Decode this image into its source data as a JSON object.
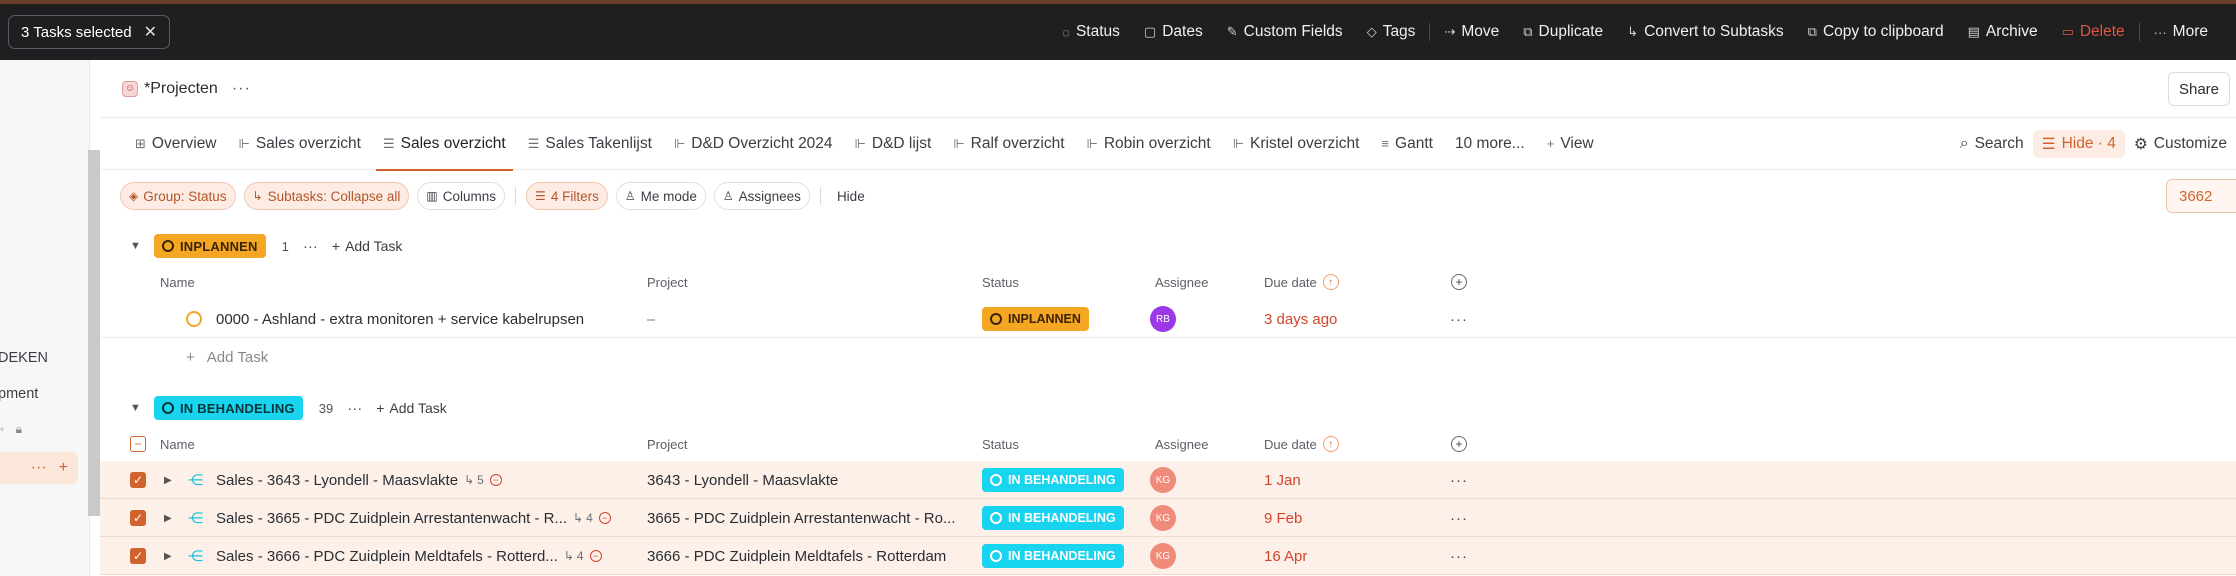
{
  "selection_bar": {
    "selected_label": "3 Tasks selected",
    "close_glyph": "✕",
    "actions": [
      {
        "label": "Status",
        "icon": "status-icon",
        "glyph": "◌"
      },
      {
        "label": "Dates",
        "icon": "calendar-icon",
        "glyph": "▢"
      },
      {
        "label": "Custom Fields",
        "icon": "edit-icon",
        "glyph": "✎"
      },
      {
        "label": "Tags",
        "icon": "tag-icon",
        "glyph": "◇"
      }
    ],
    "actions2": [
      {
        "label": "Move",
        "icon": "move-icon",
        "glyph": "⇢"
      },
      {
        "label": "Duplicate",
        "icon": "duplicate-icon",
        "glyph": "⧉"
      },
      {
        "label": "Convert to Subtasks",
        "icon": "subtask-icon",
        "glyph": "↳"
      },
      {
        "label": "Copy to clipboard",
        "icon": "copy-icon",
        "glyph": "⧉"
      },
      {
        "label": "Archive",
        "icon": "archive-icon",
        "glyph": "▤"
      },
      {
        "label": "Delete",
        "icon": "trash-icon",
        "glyph": "🗑"
      },
      {
        "label": "More",
        "icon": "more-icon",
        "glyph": "···"
      }
    ]
  },
  "sidebar": {
    "items": [
      {
        "label": "DEKEN"
      },
      {
        "label": "pment"
      }
    ]
  },
  "header": {
    "project_title": "*Projecten",
    "menu_glyph": "···",
    "share_label": "Share"
  },
  "tabs": {
    "items": [
      {
        "label": "Overview",
        "icon": "overview-icon",
        "glyph": "⊞"
      },
      {
        "label": "Sales overzicht",
        "icon": "board-icon",
        "glyph": "⊩"
      },
      {
        "label": "Sales overzicht",
        "icon": "list-icon",
        "glyph": "☰",
        "active": true
      },
      {
        "label": "Sales Takenlijst",
        "icon": "list-icon",
        "glyph": "☰"
      },
      {
        "label": "D&D Overzicht 2024",
        "icon": "board-icon",
        "glyph": "⊩"
      },
      {
        "label": "D&D lijst",
        "icon": "board-icon",
        "glyph": "⊩"
      },
      {
        "label": "Ralf overzicht",
        "icon": "board-icon",
        "glyph": "⊩"
      },
      {
        "label": "Robin overzicht",
        "icon": "board-icon",
        "glyph": "⊩"
      },
      {
        "label": "Kristel overzicht",
        "icon": "board-icon",
        "glyph": "⊩"
      },
      {
        "label": "Gantt",
        "icon": "gantt-icon",
        "glyph": "≡"
      },
      {
        "label": "10 more...",
        "icon": "",
        "glyph": ""
      },
      {
        "label": "View",
        "icon": "plus-icon",
        "glyph": "+"
      }
    ],
    "right": {
      "search": "Search",
      "hide": "Hide · 4",
      "customize": "Customize"
    }
  },
  "filters": {
    "group": "Group: Status",
    "subtasks": "Subtasks: Collapse all",
    "columns": "Columns",
    "filters": "4 Filters",
    "me_mode": "Me mode",
    "assignees": "Assignees",
    "hide": "Hide",
    "search_value": "3662"
  },
  "groups": [
    {
      "status": "INPLANNEN",
      "count": "1",
      "add_task": "Add Task",
      "columns": {
        "name": "Name",
        "project": "Project",
        "status": "Status",
        "assignee": "Assignee",
        "due": "Due date"
      },
      "tasks": [
        {
          "name": "0000 - Ashland - extra monitoren + service kabelrupsen",
          "project": "–",
          "status": "INPLANNEN",
          "assignee": "RB",
          "assignee_color": "#9b37e6",
          "due": "3 days ago"
        }
      ],
      "add_row": "Add Task"
    },
    {
      "status": "IN BEHANDELING",
      "count": "39",
      "add_task": "Add Task",
      "columns": {
        "name": "Name",
        "project": "Project",
        "status": "Status",
        "assignee": "Assignee",
        "due": "Due date"
      },
      "tasks": [
        {
          "name": "Sales - 3643 - Lyondell - Maasvlakte",
          "subtasks": "5",
          "project": "3643 - Lyondell - Maasvlakte",
          "status": "IN BEHANDELING",
          "assignee": "KG",
          "assignee_color": "#f08a7a",
          "due": "1 Jan"
        },
        {
          "name": "Sales - 3665 - PDC Zuidplein Arrestantenwacht - R...",
          "subtasks": "4",
          "project": "3665 - PDC Zuidplein Arrestantenwacht - Ro...",
          "status": "IN BEHANDELING",
          "assignee": "KG",
          "assignee_color": "#f08a7a",
          "due": "9 Feb"
        },
        {
          "name": "Sales - 3666 - PDC Zuidplein Meldtafels - Rotterd...",
          "subtasks": "4",
          "project": "3666 - PDC Zuidplein Meldtafels - Rotterdam",
          "status": "IN BEHANDELING",
          "assignee": "KG",
          "assignee_color": "#f08a7a",
          "due": "16 Apr"
        }
      ]
    }
  ]
}
